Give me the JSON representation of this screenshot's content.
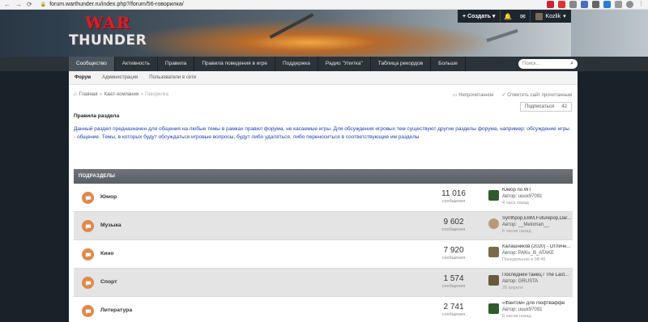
{
  "browser": {
    "url": "forum.warthunder.ru/index.php?/forum/56-говорилка/"
  },
  "header": {
    "logo_top": "WAR",
    "logo_bottom": "THUNDER",
    "create_label": "Создать",
    "username": "Kozlik"
  },
  "mainnav": {
    "items": [
      {
        "label": "Сообщество"
      },
      {
        "label": "Активность"
      },
      {
        "label": "Правила"
      },
      {
        "label": "Правила поведения в игре"
      },
      {
        "label": "Поддержка"
      },
      {
        "label": "Радио \"Улитка\""
      },
      {
        "label": "Таблица рекордов"
      },
      {
        "label": "Больше"
      }
    ],
    "search_placeholder": "Поиск..."
  },
  "subnav": {
    "items": [
      {
        "label": "Форум"
      },
      {
        "label": "Администрация"
      },
      {
        "label": "Пользователи в сети"
      }
    ]
  },
  "breadcrumb": {
    "home": "Главная",
    "section": "Кают-компания",
    "current": "Говорилка"
  },
  "marks": {
    "unread": "Непрочитанное",
    "mark_read": "Отметить сайт прочитанным"
  },
  "follow_label": "Подписаться",
  "follow_count": "42",
  "rules": {
    "title": "Правила раздела",
    "text": "Данный раздел предназначен для общения на любые темы в рамках правил форума, не касаемые игры. Для обсуждения игровых тем существуют другие разделы форума, например: обсуждение игры - общение. Темы, в которых будут обсуждаться игровые вопросы, будут либо удаляться, либо переноситься в соответствующие им разделы"
  },
  "subforums": {
    "header": "ПОДРАЗДЕЛЫ",
    "count_label": "сообщения",
    "rows": [
      {
        "title": "Юмор",
        "count": "11 016",
        "last_title": "Юмор по WT",
        "last_author": "Автор: uuux97091",
        "last_date": "4 часа назад"
      },
      {
        "title": "Музыка",
        "count": "9 602",
        "last_title": "Synthpop,EBM,Futurepop,Dar...",
        "last_author": "Автор: __Meloman__",
        "last_date": "6 часов назад"
      },
      {
        "title": "Кино",
        "count": "7 920",
        "last_title": "Калашников (2020) - Отличн...",
        "last_author": "Автор: PAKu_B_ATAKE",
        "last_date": "Понедельник в 08:45"
      },
      {
        "title": "Спорт",
        "count": "1 574",
        "last_title": "Последний танец / The Last...",
        "last_author": "Автор: GRUSTA",
        "last_date": "26 апреля"
      },
      {
        "title": "Литература",
        "count": "2 741",
        "last_title": "«Фантом» для Люфтваффе",
        "last_author": "Автор: uuux97091",
        "last_date": "5 часов назад"
      }
    ]
  },
  "colors": {
    "bubble": "#e0894b",
    "rules_text": "#1a3fb0",
    "nav_bg": "#2b3238"
  }
}
